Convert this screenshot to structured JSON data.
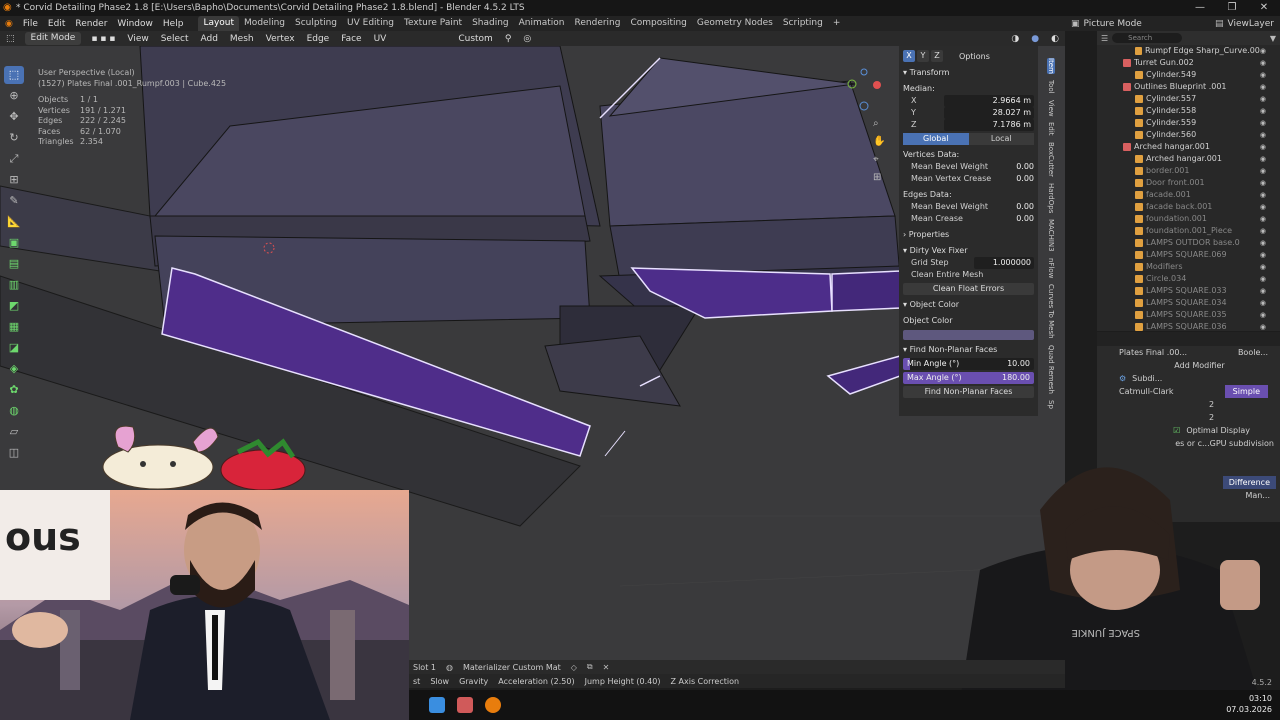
{
  "window": {
    "title": "* Corvid Detailing Phase2 1.8 [E:\\Users\\Bapho\\Documents\\Corvid Detailing Phase2 1.8.blend] - Blender 4.5.2 LTS",
    "controls": [
      "—",
      "❐",
      "✕"
    ]
  },
  "menu": {
    "items": [
      "File",
      "Edit",
      "Render",
      "Window",
      "Help"
    ],
    "workspaces": [
      "Layout",
      "Modeling",
      "Sculpting",
      "UV Editing",
      "Texture Paint",
      "Shading",
      "Animation",
      "Rendering",
      "Compositing",
      "Geometry Nodes",
      "Scripting",
      "+"
    ],
    "active_workspace": "Layout"
  },
  "top_right": {
    "scene": "Picture Mode",
    "view_layer": "ViewLayer"
  },
  "header3d": {
    "mode": "Edit Mode",
    "items": [
      "View",
      "Select",
      "Add",
      "Mesh",
      "Vertex",
      "Edge",
      "Face",
      "UV"
    ],
    "orientation": "Custom"
  },
  "overlay": {
    "view": "User Perspective (Local)",
    "object_line": "(1527) Plates Final .001_Rumpf.003 | Cube.425",
    "stats": [
      {
        "k": "Objects",
        "v": "1 / 1"
      },
      {
        "k": "Vertices",
        "v": "191 / 1.271"
      },
      {
        "k": "Edges",
        "v": "222 / 2.245"
      },
      {
        "k": "Faces",
        "v": "62 / 1.070"
      },
      {
        "k": "Triangles",
        "v": "2.354"
      }
    ]
  },
  "npanel": {
    "axes": [
      "X",
      "Y",
      "Z"
    ],
    "options": "Options",
    "transform_title": "Transform",
    "median_label": "Median:",
    "median": [
      {
        "axis": "X",
        "value": "2.9664 m"
      },
      {
        "axis": "Y",
        "value": "28.027 m"
      },
      {
        "axis": "Z",
        "value": "7.1786 m"
      }
    ],
    "space": [
      "Global",
      "Local"
    ],
    "vertices_data_title": "Vertices Data:",
    "vertices_data": [
      {
        "label": "Mean Bevel Weight",
        "value": "0.00"
      },
      {
        "label": "Mean Vertex Crease",
        "value": "0.00"
      }
    ],
    "edges_data_title": "Edges Data:",
    "edges_data": [
      {
        "label": "Mean Bevel Weight",
        "value": "0.00"
      },
      {
        "label": "Mean Crease",
        "value": "0.00"
      }
    ],
    "properties_title": "Properties",
    "dirty_title": "Dirty Vex Fixer",
    "grid_step_label": "Grid Step",
    "grid_step_value": "1.000000",
    "clean_mesh": "Clean Entire Mesh",
    "clean_float": "Clean Float Errors",
    "object_color_title": "Object Color",
    "object_color_label": "Object Color",
    "object_color_hex": "#5e587e",
    "nonplanar_title": "Find Non-Planar Faces",
    "min_angle_label": "Min Angle (°)",
    "min_angle_value": "10.00",
    "min_angle_fraction": 0.056,
    "max_angle_label": "Max Angle (°)",
    "max_angle_value": "180.00",
    "max_angle_fraction": 1.0,
    "find_button": "Find Non-Planar Faces"
  },
  "vtabs": [
    "Item",
    "Tool",
    "View",
    "Edit",
    "BoxCutter",
    "HardOps",
    "MACHIN3",
    "nFlow",
    "Curves To Mesh",
    "Quad Remesh",
    "Sp"
  ],
  "outliner": {
    "search_placeholder": "Search",
    "items": [
      {
        "label": "Rumpf Edge Sharp_Curve.00",
        "dim": false
      },
      {
        "label": "Turret Gun.002",
        "dim": false
      },
      {
        "label": "Cylinder.549",
        "dim": false
      },
      {
        "label": "Outlines Blueprint .001",
        "dim": false
      },
      {
        "label": "Cylinder.557",
        "dim": false
      },
      {
        "label": "Cylinder.558",
        "dim": false
      },
      {
        "label": "Cylinder.559",
        "dim": false
      },
      {
        "label": "Cylinder.560",
        "dim": false
      },
      {
        "label": "Arched hangar.001",
        "dim": false
      },
      {
        "label": "Arched hangar.001",
        "dim": false
      },
      {
        "label": "border.001",
        "dim": true
      },
      {
        "label": "Door front.001",
        "dim": true
      },
      {
        "label": "facade.001",
        "dim": true
      },
      {
        "label": "facade back.001",
        "dim": true
      },
      {
        "label": "foundation.001",
        "dim": true
      },
      {
        "label": "foundation.001_Piece",
        "dim": true
      },
      {
        "label": "LAMPS OUTDOR base.0",
        "dim": true
      },
      {
        "label": "LAMPS SQUARE.069",
        "dim": true
      },
      {
        "label": "Modifiers",
        "dim": true
      },
      {
        "label": "Circle.034",
        "dim": true
      },
      {
        "label": "LAMPS SQUARE.033",
        "dim": true
      },
      {
        "label": "LAMPS SQUARE.034",
        "dim": true
      },
      {
        "label": "LAMPS SQUARE.035",
        "dim": true
      },
      {
        "label": "LAMPS SQUARE.036",
        "dim": true
      }
    ]
  },
  "properties": {
    "object": "Plates Final .00...",
    "boolean": "Boole...",
    "add_modifier": "Add Modifier",
    "modifier_name": "Subdi...",
    "catmull": "Catmull-Clark",
    "simple": "Simple",
    "levels": [
      "2",
      "2"
    ],
    "optimal_display": "Optimal Display",
    "gpu_text": "es or c...GPU subdivision",
    "difference": "Difference",
    "man": "Man..."
  },
  "statusbar": {
    "slot": "Slot 1",
    "material": "Materializer Custom Mat",
    "row2": [
      "st",
      "Slow",
      "Gravity",
      "Acceleration (2.50)",
      "Jump Height (0.40)",
      "Z Axis Correction"
    ]
  },
  "version": "4.5.2",
  "clock": {
    "time": "03:10",
    "date": "07.03.2026"
  },
  "webcam": {
    "shirt_text": "SPACE JUNKIE",
    "sign_text": "ous"
  }
}
